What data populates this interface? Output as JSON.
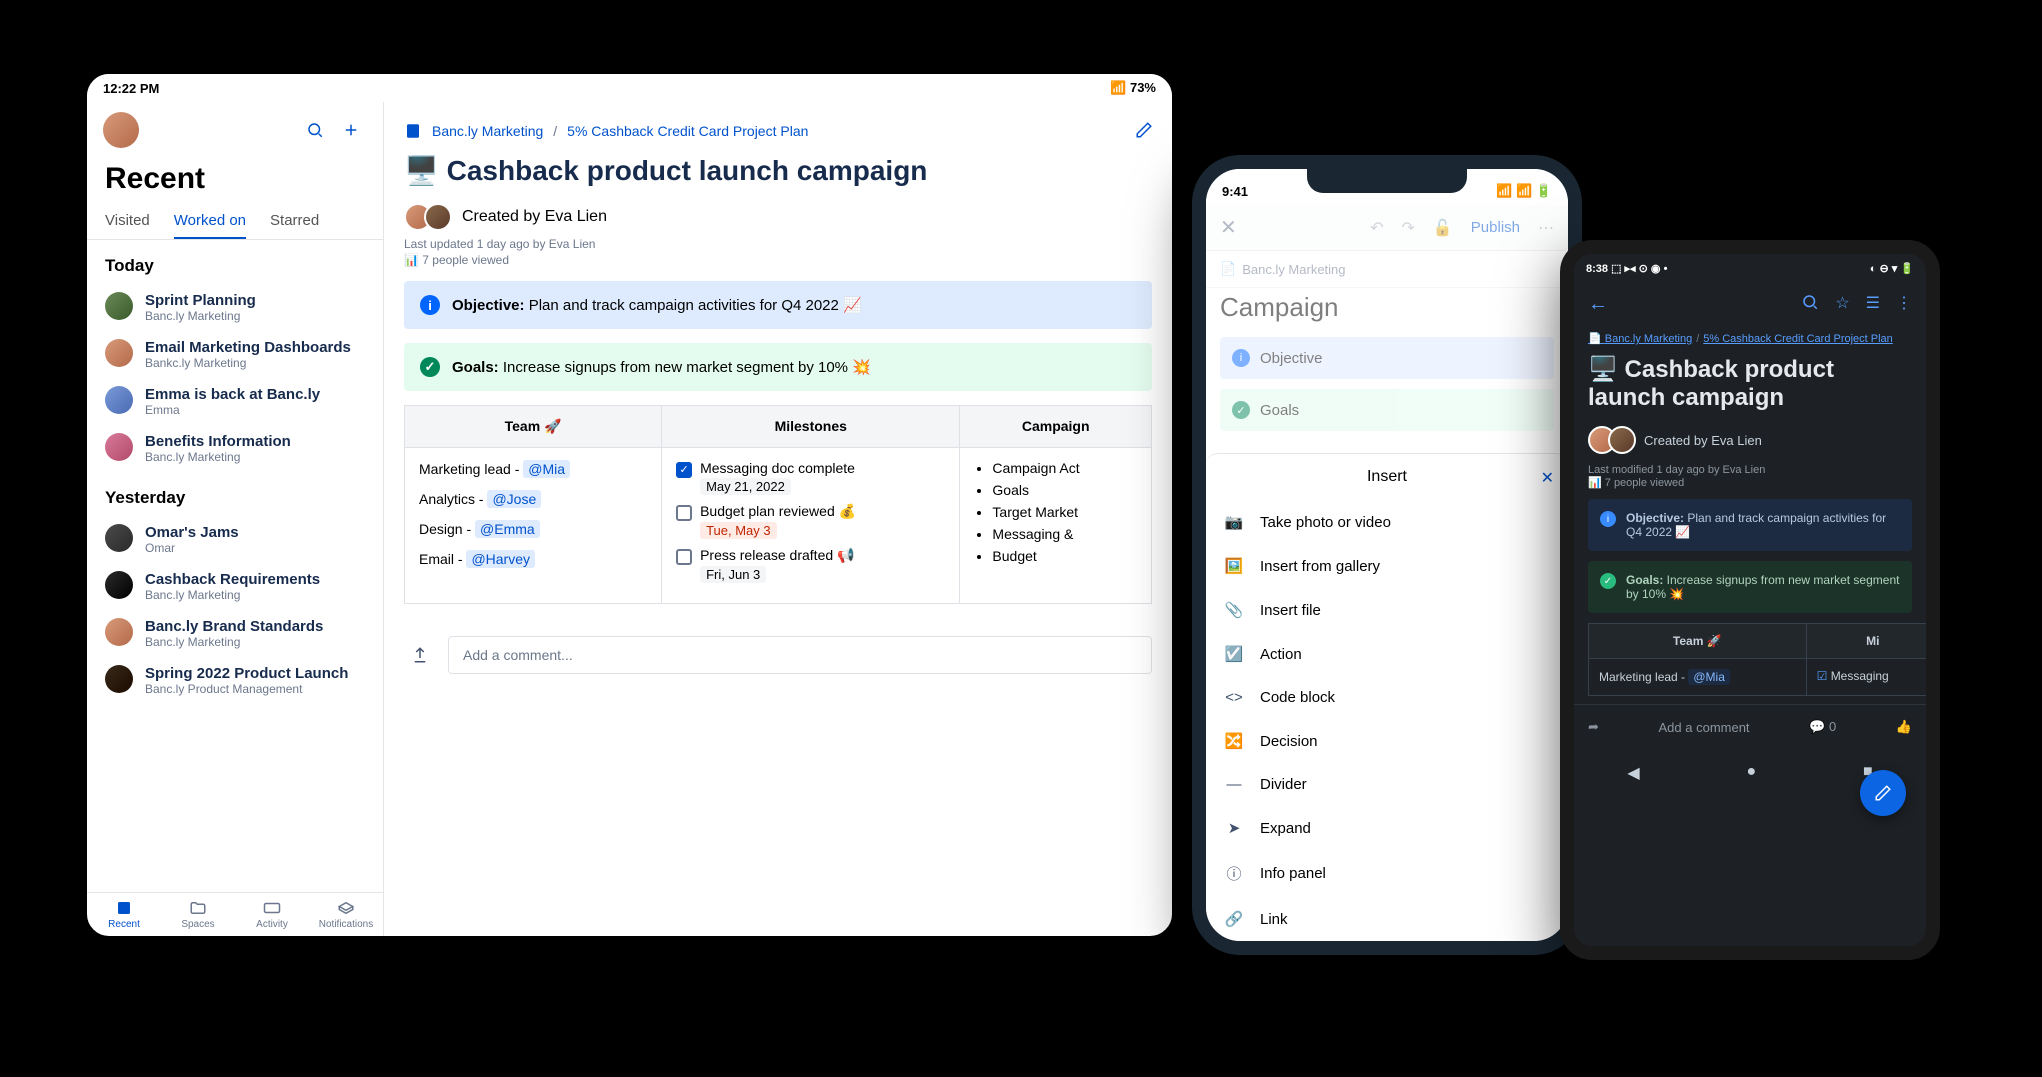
{
  "tablet": {
    "status": {
      "time": "12:22 PM",
      "battery": "73%"
    },
    "sidebar": {
      "heading": "Recent",
      "tabs": [
        "Visited",
        "Worked on",
        "Starred"
      ],
      "activeTab": 1,
      "sections": [
        {
          "label": "Today",
          "items": [
            {
              "title": "Sprint Planning",
              "sub": "Banc.ly Marketing"
            },
            {
              "title": "Email Marketing Dashboards",
              "sub": "Bankc.ly Marketing"
            },
            {
              "title": "Emma is back at Banc.ly",
              "sub": "Emma"
            },
            {
              "title": "Benefits Information",
              "sub": "Banc.ly Marketing"
            }
          ]
        },
        {
          "label": "Yesterday",
          "items": [
            {
              "title": "Omar's Jams",
              "sub": "Omar"
            },
            {
              "title": "Cashback Requirements",
              "sub": "Banc.ly Marketing"
            },
            {
              "title": "Banc.ly Brand Standards",
              "sub": "Banc.ly Marketing"
            },
            {
              "title": "Spring 2022 Product Launch",
              "sub": "Banc.ly Product Management"
            }
          ]
        }
      ],
      "bottom": [
        "Recent",
        "Spaces",
        "Activity",
        "Notifications"
      ]
    },
    "page": {
      "breadcrumb": [
        "Banc.ly Marketing",
        "5% Cashback Credit Card Project Plan"
      ],
      "title": "🖥️ Cashback product launch campaign",
      "created": "Created by Eva Lien",
      "updated": "Last updated 1 day ago by Eva Lien",
      "viewed": "7 people viewed",
      "objective_label": "Objective:",
      "objective": " Plan and track campaign activities for Q4 2022 📈",
      "goals_label": "Goals:",
      "goals": " Increase signups from new market segment by 10% 💥",
      "table": {
        "headers": [
          "Team 🚀",
          "Milestones",
          "Campaign"
        ],
        "team": [
          {
            "role": "Marketing lead",
            "name": "@Mia"
          },
          {
            "role": "Analytics",
            "name": "@Jose"
          },
          {
            "role": "Design",
            "name": "@Emma"
          },
          {
            "role": "Email",
            "name": "@Harvey"
          }
        ],
        "milestones": [
          {
            "done": true,
            "text": "Messaging doc complete",
            "date": "May 21, 2022",
            "dateStyle": ""
          },
          {
            "done": false,
            "text": "Budget plan reviewed 💰",
            "date": "Tue, May 3",
            "dateStyle": "red"
          },
          {
            "done": false,
            "text": "Press release drafted 📢",
            "date": "Fri, Jun 3",
            "dateStyle": ""
          }
        ],
        "campaign": [
          "Campaign Act",
          "Goals",
          "Target Market",
          "Messaging & ",
          "Budget"
        ]
      },
      "commentPlaceholder": "Add a comment..."
    }
  },
  "phone1": {
    "status": {
      "time": "9:41"
    },
    "publish": "Publish",
    "space": "Banc.ly Marketing",
    "title": "Campaign",
    "objective": "Objective",
    "goals": "Goals",
    "sheet": {
      "title": "Insert",
      "items": [
        "Take photo or video",
        "Insert from gallery",
        "Insert file",
        "Action",
        "Code block",
        "Decision",
        "Divider",
        "Expand",
        "Info panel",
        "Link"
      ]
    }
  },
  "phone2": {
    "status": {
      "time": "8:38"
    },
    "breadcrumb": [
      "Banc.ly Marketing",
      "5% Cashback Credit Card Project Plan"
    ],
    "title": "🖥️ Cashback product launch campaign",
    "created": "Created by Eva Lien",
    "modified": "Last modified 1 day ago by Eva Lien",
    "viewed": "7 people viewed",
    "objective_label": "Objective:",
    "objective": " Plan and track campaign activities for Q4 2022 📈",
    "goals_label": "Goals:",
    "goals": " Increase signups from new market segment by 10% 💥",
    "th_team": "Team 🚀",
    "th_mile": "Mi",
    "row_team": "Marketing lead - ",
    "row_mention": "@Mia",
    "row_mile": "Messaging",
    "comment": "Add a comment",
    "commentCount": "0"
  }
}
